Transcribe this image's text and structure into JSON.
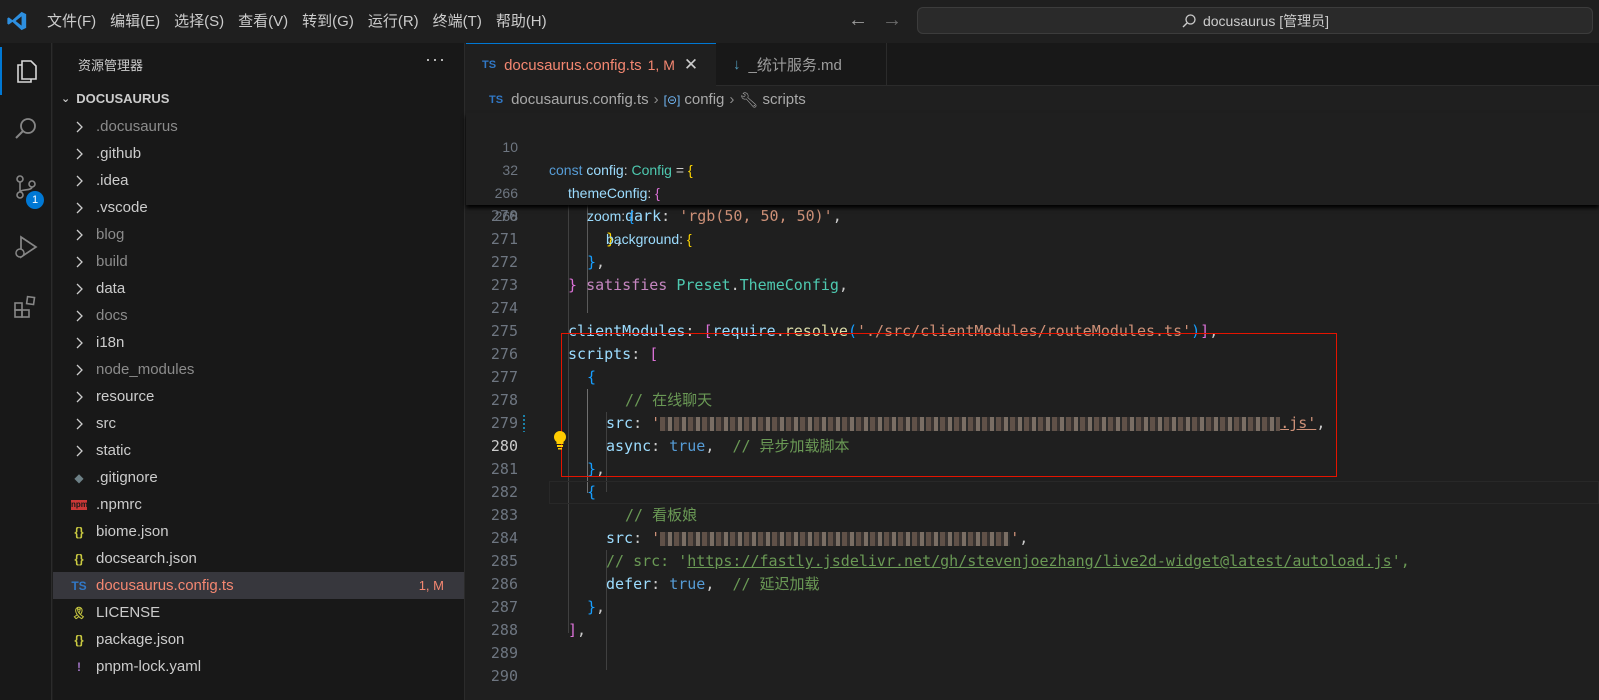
{
  "menu": [
    "文件(F)",
    "编辑(E)",
    "选择(S)",
    "查看(V)",
    "转到(G)",
    "运行(R)",
    "终端(T)",
    "帮助(H)"
  ],
  "command_center": "docusaurus [管理员]",
  "activity": {
    "scm_badge": "1"
  },
  "sidebar": {
    "title": "资源管理器",
    "more": "···",
    "root": "DOCUSAURUS",
    "items": [
      {
        "label": ".docusaurus",
        "type": "folder",
        "dim": true
      },
      {
        "label": ".github",
        "type": "folder"
      },
      {
        "label": ".idea",
        "type": "folder"
      },
      {
        "label": ".vscode",
        "type": "folder"
      },
      {
        "label": "blog",
        "type": "folder",
        "dim": true
      },
      {
        "label": "build",
        "type": "folder",
        "dim": true
      },
      {
        "label": "data",
        "type": "folder"
      },
      {
        "label": "docs",
        "type": "folder",
        "dim": true
      },
      {
        "label": "i18n",
        "type": "folder"
      },
      {
        "label": "node_modules",
        "type": "folder",
        "dim": true
      },
      {
        "label": "resource",
        "type": "folder"
      },
      {
        "label": "src",
        "type": "folder"
      },
      {
        "label": "static",
        "type": "folder"
      },
      {
        "label": ".gitignore",
        "type": "file",
        "icon": "◆",
        "icon_color": "#6d8086"
      },
      {
        "label": ".npmrc",
        "type": "file",
        "icon": "npm",
        "icon_color": "#cb3837"
      },
      {
        "label": "biome.json",
        "type": "file",
        "icon": "{}",
        "icon_color": "#cbcb41"
      },
      {
        "label": "docsearch.json",
        "type": "file",
        "icon": "{}",
        "icon_color": "#cbcb41"
      },
      {
        "label": "docusaurus.config.ts",
        "type": "file",
        "icon": "TS",
        "icon_color": "#3178c6",
        "status": "1, M",
        "selected": true,
        "red": true
      },
      {
        "label": "LICENSE",
        "type": "file",
        "icon": "🎗",
        "icon_color": "#cbcb41"
      },
      {
        "label": "package.json",
        "type": "file",
        "icon": "{}",
        "icon_color": "#cbcb41"
      },
      {
        "label": "pnpm-lock.yaml",
        "type": "file",
        "icon": "!",
        "icon_color": "#a074c4"
      }
    ]
  },
  "tabs": [
    {
      "icon": "TS",
      "label": "docusaurus.config.ts",
      "status": "1, M",
      "active": true
    },
    {
      "icon": "↓",
      "label": "_统计服务.md",
      "active": false
    }
  ],
  "breadcrumb": {
    "file_icon": "TS",
    "file": "docusaurus.config.ts",
    "item1": "config",
    "item2": "scripts"
  },
  "code": {
    "sticky": [
      {
        "n": "10",
        "text": "const config: Config = {"
      },
      {
        "n": "32",
        "text": "themeConfig: {"
      },
      {
        "n": "266",
        "text": "zoom: {"
      },
      {
        "n": "268",
        "text": "background: {"
      }
    ],
    "lines": [
      {
        "n": "270",
        "text": "dark: 'rgb(50, 50, 50)',"
      },
      {
        "n": "271",
        "text": "},"
      },
      {
        "n": "272",
        "text": "},"
      },
      {
        "n": "273",
        "text": "} satisfies Preset.ThemeConfig,"
      },
      {
        "n": "274",
        "text": ""
      },
      {
        "n": "275",
        "text": "clientModules: [require.resolve('./src/clientModules/routeModules.ts')],"
      },
      {
        "n": "276",
        "text": "scripts: ["
      },
      {
        "n": "277",
        "text": "{"
      },
      {
        "n": "278",
        "text": "// 在线聊天"
      },
      {
        "n": "279",
        "text": "src: '",
        "tail": ".js',"
      },
      {
        "n": "280",
        "text": "async: true,  // 异步加载脚本"
      },
      {
        "n": "281",
        "text": "},"
      },
      {
        "n": "282",
        "text": "{"
      },
      {
        "n": "283",
        "text": "// 看板娘"
      },
      {
        "n": "284",
        "text": "src: '",
        "tail": "',"
      },
      {
        "n": "285",
        "text": "// src: 'https://fastly.jsdelivr.net/gh/stevenjoezhang/live2d-widget@latest/autoload.js',"
      },
      {
        "n": "286",
        "text": "defer: true,  // 延迟加载"
      },
      {
        "n": "287",
        "text": "},"
      },
      {
        "n": "288",
        "text": "],"
      },
      {
        "n": "289",
        "text": ""
      },
      {
        "n": "290",
        "text": ""
      }
    ]
  },
  "colors": {
    "accent": "#0078d4",
    "highlight_box": "#e51400",
    "modified": "#e2c08d",
    "error": "#f48771"
  }
}
